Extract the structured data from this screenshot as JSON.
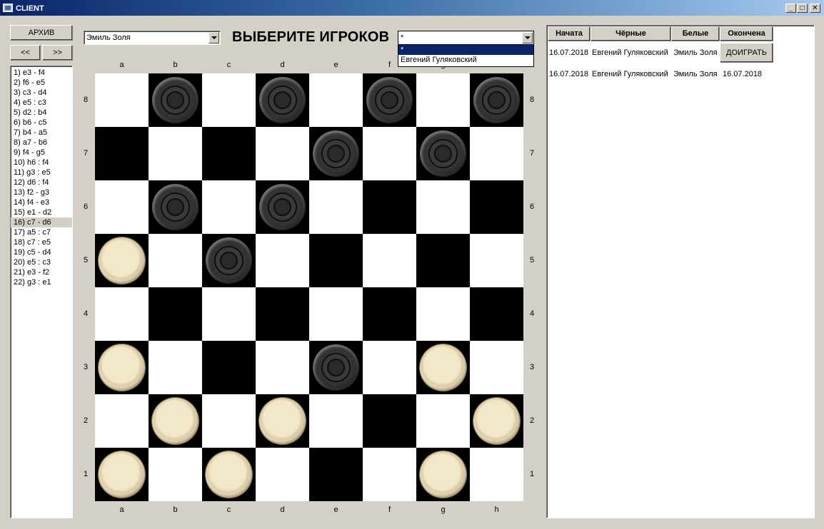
{
  "window": {
    "title": "CLIENT",
    "minimize": "_",
    "maximize": "□",
    "close": "✕"
  },
  "buttons": {
    "archive": "АРХИВ",
    "prev": "<<",
    "next": ">>",
    "continue": "ДОИГРАТЬ"
  },
  "moves": [
    "1) e3 - f4",
    "2) f6 - e5",
    "3) c3 - d4",
    "4) e5 : c3",
    "5) d2 : b4",
    "6) b6 - c5",
    "7) b4 - a5",
    "8) a7 - b6",
    "9) f4 - g5",
    "10) h6 : f4",
    "11) g3 : e5",
    "12) d6 : f4",
    "13) f2 - g3",
    "14) f4 - e3",
    "15) e1 - d2",
    "16) c7 - d6",
    "17) a5 : c7",
    "18) c7 : e5",
    "19) c5 - d4",
    "20) e5 : c3",
    "21) e3 - f2",
    "22) g3 : e1"
  ],
  "selected_move_index": 15,
  "player_select_left": {
    "value": "Эмиль Золя"
  },
  "heading": "ВЫБЕРИТЕ ИГРОКОВ",
  "player_select_right": {
    "value": "*",
    "options": [
      "*",
      "Евгений Гуляковский"
    ]
  },
  "board": {
    "files": [
      "a",
      "b",
      "c",
      "d",
      "e",
      "f",
      "g",
      "h"
    ],
    "ranks": [
      "8",
      "7",
      "6",
      "5",
      "4",
      "3",
      "2",
      "1"
    ],
    "pieces": [
      {
        "square": "b8",
        "color": "black"
      },
      {
        "square": "d8",
        "color": "black"
      },
      {
        "square": "f8",
        "color": "black"
      },
      {
        "square": "h8",
        "color": "black"
      },
      {
        "square": "e7",
        "color": "black"
      },
      {
        "square": "g7",
        "color": "black"
      },
      {
        "square": "b6",
        "color": "black"
      },
      {
        "square": "d6",
        "color": "black"
      },
      {
        "square": "a5",
        "color": "white"
      },
      {
        "square": "c5",
        "color": "black"
      },
      {
        "square": "a3",
        "color": "white"
      },
      {
        "square": "e3",
        "color": "black"
      },
      {
        "square": "g3",
        "color": "white"
      },
      {
        "square": "b2",
        "color": "white"
      },
      {
        "square": "d2",
        "color": "white"
      },
      {
        "square": "h2",
        "color": "white"
      },
      {
        "square": "a1",
        "color": "white"
      },
      {
        "square": "c1",
        "color": "white"
      },
      {
        "square": "g1",
        "color": "white"
      }
    ]
  },
  "games_table": {
    "headers": {
      "started": "Начата",
      "black": "Чёрные",
      "white": "Белые",
      "finished": "Окончена"
    },
    "rows": [
      {
        "started": "16.07.2018",
        "black": "Евгений Гуляковский",
        "white": "Эмиль Золя",
        "finished": "",
        "action": "ДОИГРАТЬ"
      },
      {
        "started": "16.07.2018",
        "black": "Евгений Гуляковский",
        "white": "Эмиль Золя",
        "finished": "16.07.2018"
      }
    ]
  }
}
